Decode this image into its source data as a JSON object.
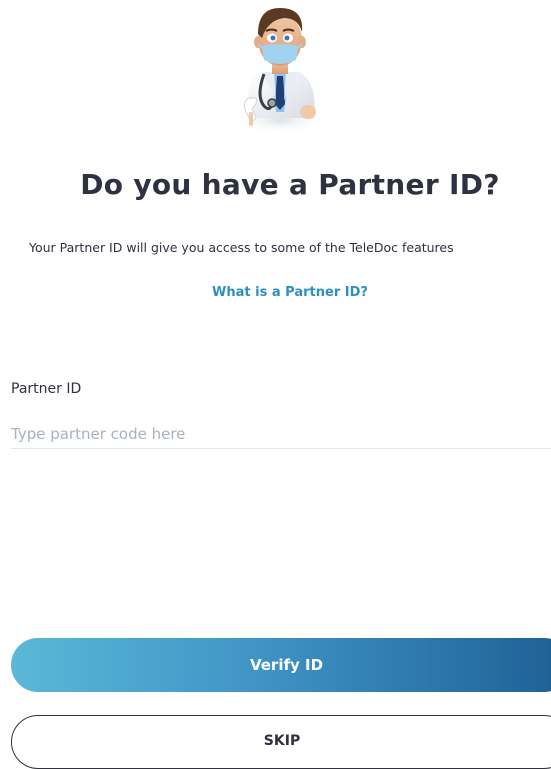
{
  "hero": {
    "image": "doctor-mascot-pointing-down-illustration"
  },
  "header": {
    "title": "Do you have a Partner ID?",
    "subtitle": "Your Partner ID will give you access to some of the TeleDoc features",
    "info_link": "What is a Partner ID?"
  },
  "form": {
    "label": "Partner ID",
    "value": "",
    "placeholder": "Type partner code here"
  },
  "actions": {
    "verify_label": "Verify ID",
    "skip_label": "SKIP"
  },
  "colors": {
    "text": "#2f3140",
    "link": "#2f8fc4",
    "placeholder": "#a9b3be",
    "gradient_start": "#5bb8d8",
    "gradient_end": "#1d5f95"
  }
}
